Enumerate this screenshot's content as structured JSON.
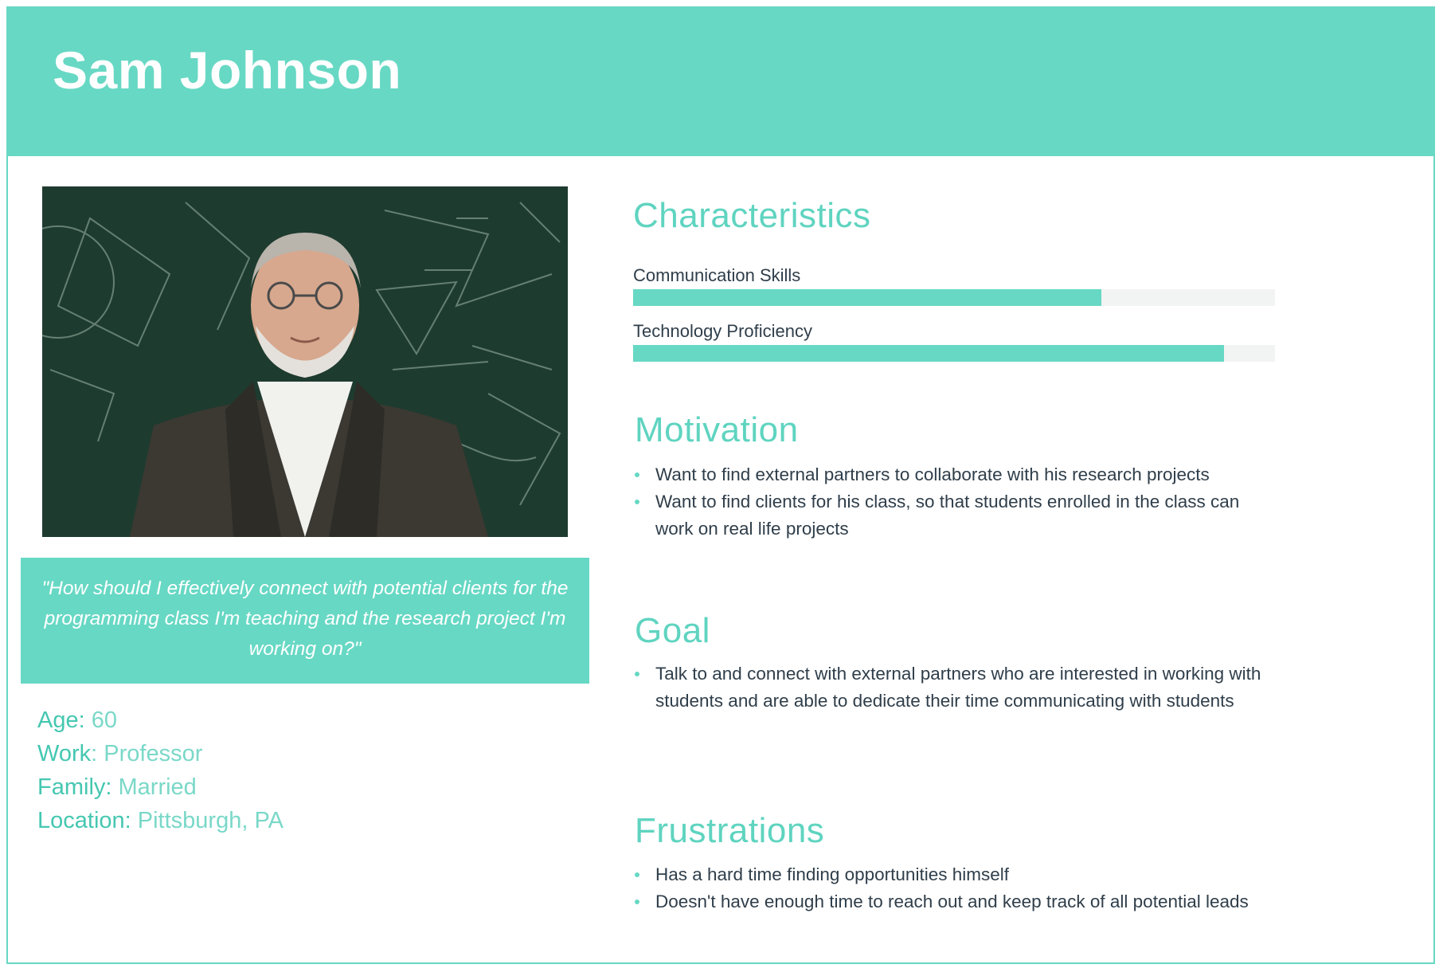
{
  "persona": {
    "name": "Sam Johnson"
  },
  "photo": {
    "alt": "Portrait of Sam Johnson in front of a chalkboard"
  },
  "quote": "\"How should I effectively connect with potential clients for the programming class I'm teaching and the research project I'm working on?\"",
  "demographics": [
    {
      "key": "Age:",
      "value": " 60"
    },
    {
      "key": "Work",
      "value": ": Professor"
    },
    {
      "key": "Family:",
      "value": " Married"
    },
    {
      "key": "Location:",
      "value": " Pittsburgh, PA"
    }
  ],
  "characteristics": {
    "title": "Characteristics",
    "skills": [
      {
        "label": "Communication Skills",
        "level": 0.73
      },
      {
        "label": "Technology Proficiency",
        "level": 0.92
      }
    ]
  },
  "motivation": {
    "title": "Motivation",
    "items": [
      "Want to find external partners to collaborate with his research projects",
      "Want to find clients for his class, so that students enrolled in the class can work on real life projects"
    ]
  },
  "goal": {
    "title": "Goal",
    "items": [
      "Talk to and connect with external partners who are interested in working with students and are able to dedicate their time communicating with students"
    ]
  },
  "frustrations": {
    "title": "Frustrations",
    "items": [
      "Has a hard time finding opportunities himself",
      "Doesn't have enough time to reach out and keep track of all potential leads"
    ]
  },
  "colors": {
    "accent": "#67d8c4",
    "text": "#2f3e4a",
    "track": "#f2f3f3"
  }
}
